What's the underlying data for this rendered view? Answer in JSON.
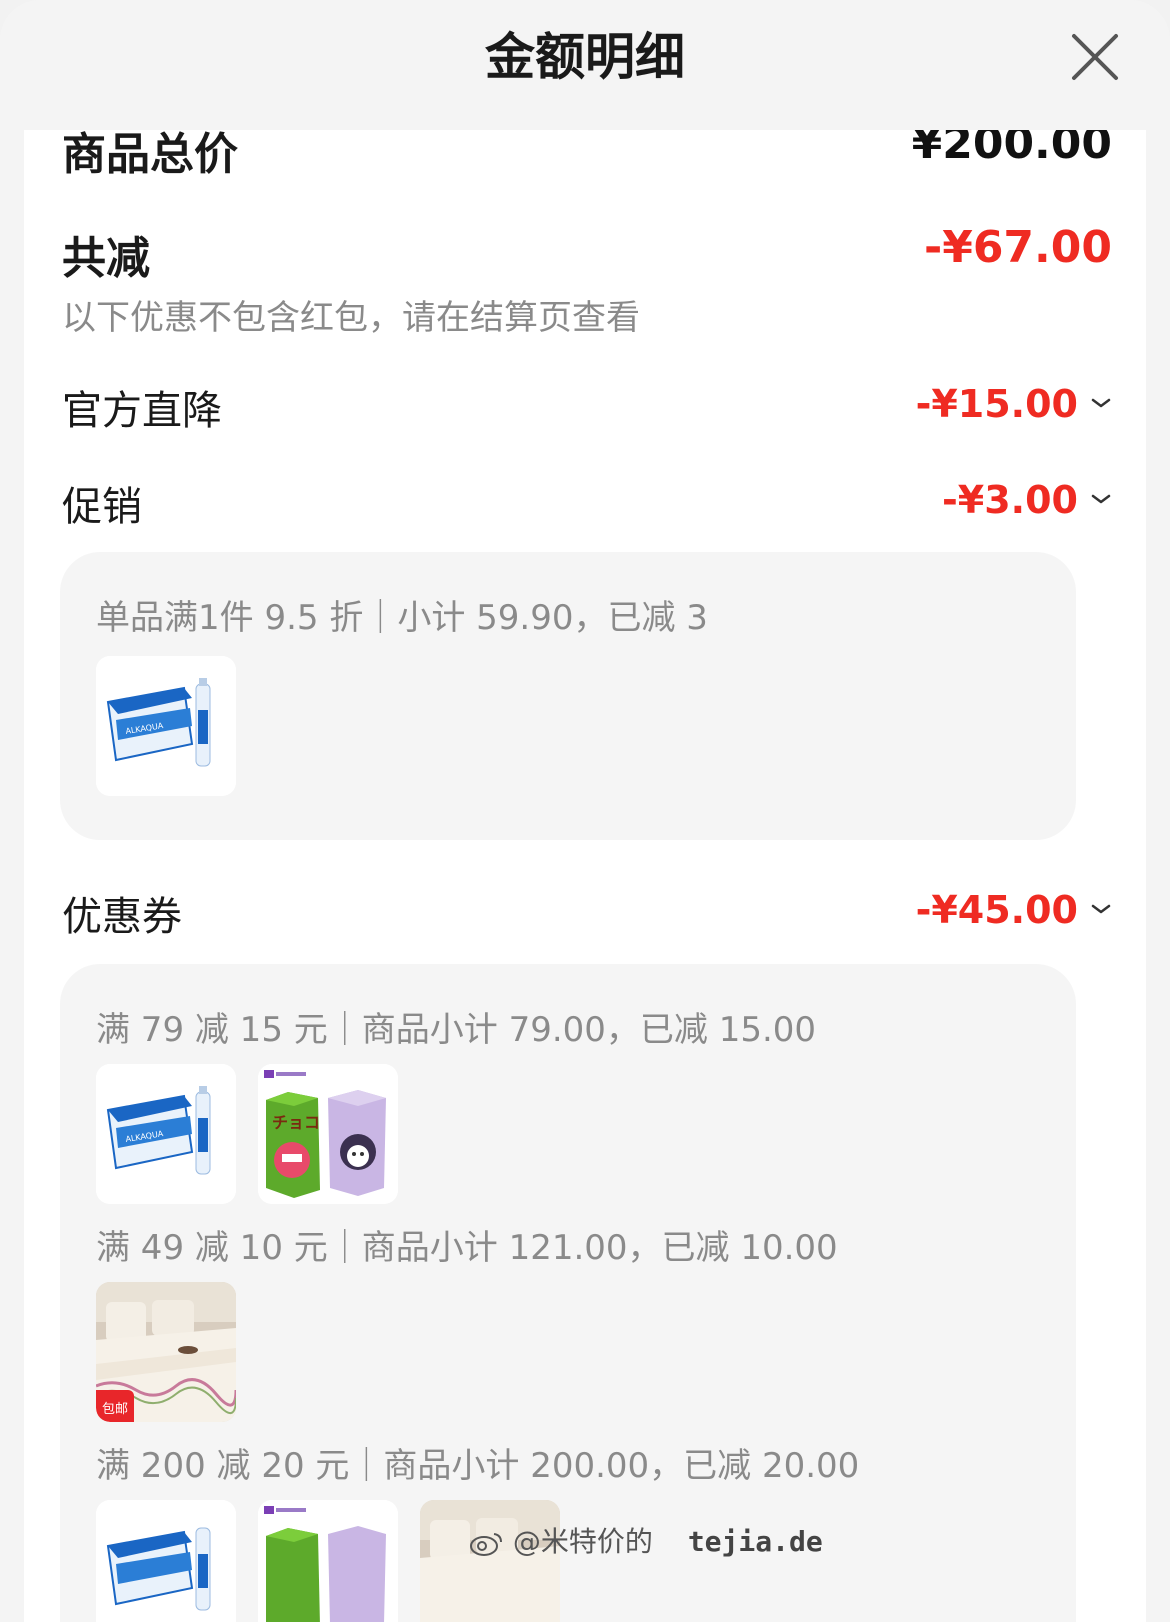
{
  "header": {
    "title": "金额明细",
    "close_icon": "close-icon"
  },
  "summary": {
    "total_label": "商品总价",
    "total_value": "¥200.00",
    "reduce_label": "共减",
    "reduce_value": "-¥67.00",
    "note": "以下优惠不包含红包，请在结算页查看"
  },
  "discounts": [
    {
      "label": "官方直降",
      "value": "-¥15.00"
    },
    {
      "label": "促销",
      "value": "-¥3.00"
    },
    {
      "label": "优惠券",
      "value": "-¥45.00"
    }
  ],
  "promo_card": {
    "line": "单品满1件 9.5 折｜小计 59.90，已减 3",
    "products": [
      "water-box"
    ]
  },
  "coupon_card": {
    "groups": [
      {
        "line": "满 79 减 15 元｜商品小计 79.00，已减 15.00",
        "products": [
          "water-box",
          "snack-boxes"
        ]
      },
      {
        "line": "满 49 减 10 元｜商品小计 121.00，已减 10.00",
        "products": [
          "sofa-cover"
        ]
      },
      {
        "line": "满 200 减 20 元｜商品小计 200.00，已减 20.00",
        "products": [
          "water-box",
          "snack-boxes",
          "sofa-cover"
        ]
      }
    ]
  },
  "badges": {
    "free_shipping": "包邮"
  },
  "watermark": {
    "handle": "@米特价的",
    "site": "tejia.de"
  },
  "colors": {
    "accent_red": "#ef2b22",
    "text_dark": "#1a1a1a",
    "text_gray": "#8a8a8a",
    "card_bg": "#f5f5f5"
  }
}
